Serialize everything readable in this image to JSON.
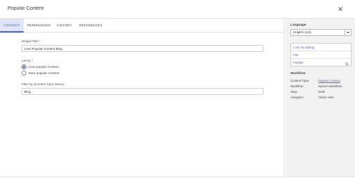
{
  "dialog": {
    "title": "Popular Content"
  },
  "tabs": [
    {
      "label": "CONTENT",
      "active": true
    },
    {
      "label": "PERMISSIONS",
      "active": false
    },
    {
      "label": "HISTORY",
      "active": false
    },
    {
      "label": "REFERENCES",
      "active": false
    }
  ],
  "form": {
    "widget_title_label": "Widget Title *",
    "widget_title_value": "Less Popular Content Blog",
    "list_by_label": "List by *",
    "list_by_options": [
      {
        "label": "Less popular Content",
        "checked": true
      },
      {
        "label": "More popular Content",
        "checked": false
      }
    ],
    "filter_label": "Filter by (Content Type Name)",
    "filter_value": "Blog"
  },
  "sidebar": {
    "language_label": "Language",
    "language_value": "English (US)",
    "actions": [
      {
        "label": "Lock for Editing"
      },
      {
        "label": "File"
      },
      {
        "label": "Publish"
      }
    ],
    "workflow_label": "Workflow",
    "workflow": [
      {
        "key": "Content Type:",
        "value": "Popular Content",
        "link": true
      },
      {
        "key": "Workflow:",
        "value": "System Workflow",
        "link": false
      },
      {
        "key": "Step:",
        "value": "Draft",
        "link": false
      },
      {
        "key": "Assignee:",
        "value": "Admin User",
        "link": false
      }
    ]
  },
  "colors": {
    "accent": "#4a5fd1",
    "active_tab_bg": "#dde4fb",
    "sidebar_bg": "#f2f2f2"
  },
  "icons": {
    "close": "close-icon",
    "language_dropdown": "chevron-down-icon",
    "publish_search": "search-icon"
  }
}
